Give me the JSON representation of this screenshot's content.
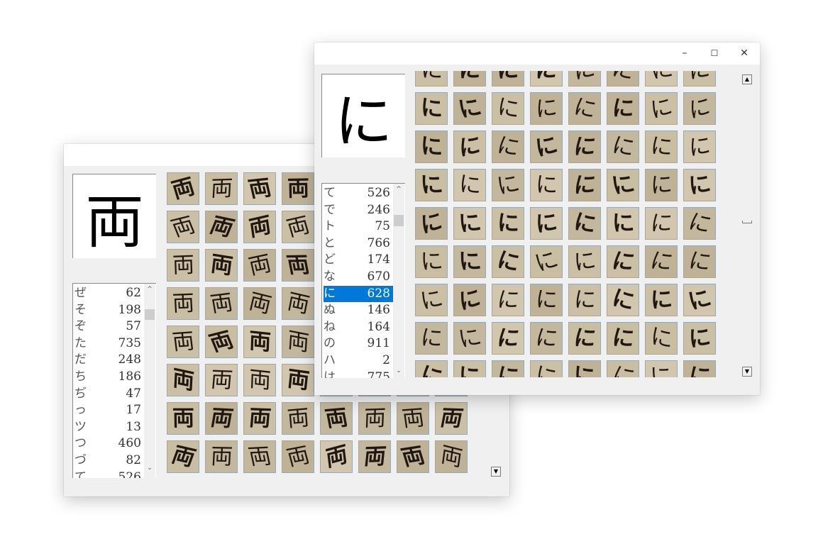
{
  "front_window": {
    "controls": {
      "minimize": "–",
      "maximize": "☐",
      "close": "✕"
    },
    "selected_char": "に",
    "tile_glyph": "に",
    "list_items": [
      {
        "kana": "て",
        "count": "526"
      },
      {
        "kana": "で",
        "count": "246"
      },
      {
        "kana": "ト",
        "count": "75"
      },
      {
        "kana": "と",
        "count": "766"
      },
      {
        "kana": "ど",
        "count": "174"
      },
      {
        "kana": "な",
        "count": "670"
      },
      {
        "kana": "に",
        "count": "628"
      },
      {
        "kana": "ぬ",
        "count": "146"
      },
      {
        "kana": "ね",
        "count": "164"
      },
      {
        "kana": "の",
        "count": "911"
      },
      {
        "kana": "ハ",
        "count": "2"
      },
      {
        "kana": "は",
        "count": "775"
      }
    ],
    "selected_index": 6
  },
  "back_window": {
    "selected_char": "両",
    "tile_glyph": "両",
    "list_items": [
      {
        "kana": "ぜ",
        "count": "62"
      },
      {
        "kana": "そ",
        "count": "198"
      },
      {
        "kana": "ぞ",
        "count": "57"
      },
      {
        "kana": "た",
        "count": "735"
      },
      {
        "kana": "だ",
        "count": "248"
      },
      {
        "kana": "ち",
        "count": "186"
      },
      {
        "kana": "ぢ",
        "count": "47"
      },
      {
        "kana": "っ",
        "count": "17"
      },
      {
        "kana": "ツ",
        "count": "13"
      },
      {
        "kana": "つ",
        "count": "460"
      },
      {
        "kana": "づ",
        "count": "82"
      },
      {
        "kana": "て",
        "count": "526"
      }
    ]
  },
  "icons": {
    "list_scroll_up": "chevron-up-icon",
    "list_scroll_down": "chevron-down-icon",
    "grid_scroll_up": "triangle-up-icon",
    "grid_scroll_down": "triangle-down-icon"
  },
  "colors": {
    "selection": "#0078d7",
    "window_bg": "#f0f0f0",
    "tile_paper": "#c6bba4",
    "tile_ink": "#1f1710"
  }
}
